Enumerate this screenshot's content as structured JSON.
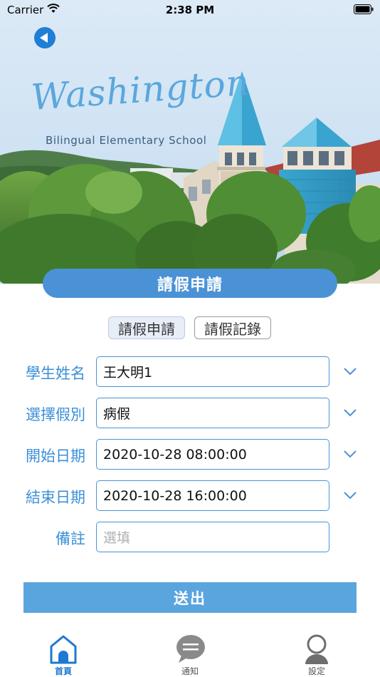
{
  "status_bar": {
    "carrier": "Carrier",
    "time": "2:38 PM"
  },
  "hero": {
    "school_name_script": "Washington",
    "school_name_sub": "Bilingual Elementary School"
  },
  "banner": {
    "title": "請假申請"
  },
  "tabs": [
    {
      "label": "請假申請",
      "selected": true
    },
    {
      "label": "請假記錄",
      "selected": false
    }
  ],
  "form": {
    "student_name": {
      "label": "學生姓名",
      "value": "王大明1"
    },
    "leave_type": {
      "label": "選擇假別",
      "value": "病假"
    },
    "start_date": {
      "label": "開始日期",
      "value": "2020-10-28 08:00:00"
    },
    "end_date": {
      "label": "結束日期",
      "value": "2020-10-28 16:00:00"
    },
    "note": {
      "label": "備註",
      "placeholder": "選填"
    }
  },
  "submit": {
    "label": "送出"
  },
  "tab_bar": {
    "home": {
      "label": "首頁",
      "icon": "house-icon"
    },
    "notifications": {
      "label": "通知",
      "icon": "chat-bubble-icon"
    },
    "settings": {
      "label": "設定",
      "icon": "person-icon"
    }
  },
  "colors": {
    "accent": "#4a92d5",
    "label_blue": "#3b8fd8",
    "submit_blue": "#5ba5de",
    "active_tab_blue": "#1f78d1"
  }
}
